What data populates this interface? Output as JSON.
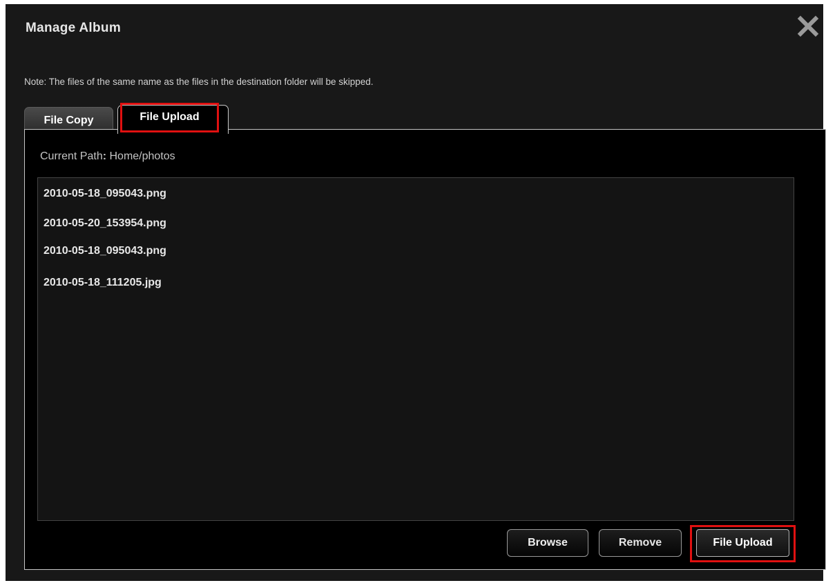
{
  "dialog": {
    "title": "Manage Album",
    "close_icon": "close-x-icon"
  },
  "note": "Note: The files of the same name as the files in the destination folder will be skipped.",
  "tabs": [
    {
      "label": "File Copy",
      "active": false
    },
    {
      "label": "File Upload",
      "active": true,
      "highlighted": true
    }
  ],
  "current_path": {
    "label": "Current Path",
    "separator": ":",
    "value": "Home/photos"
  },
  "files": [
    "2010-05-18_095043.png",
    "2010-05-20_153954.png",
    "2010-05-18_095043.png",
    "2010-05-18_111205.jpg"
  ],
  "buttons": {
    "browse": "Browse",
    "remove": "Remove",
    "file_upload": "File Upload"
  },
  "colors": {
    "dialog_bg": "#181818",
    "panel_bg": "#000000",
    "highlight": "#e01010",
    "text": "#e8e8e8"
  }
}
